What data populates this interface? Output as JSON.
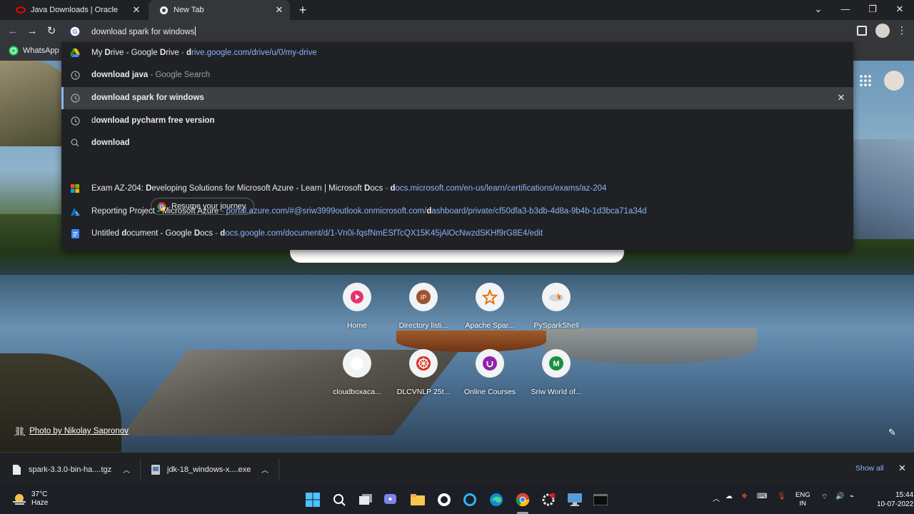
{
  "tabs": [
    {
      "title": "Java Downloads | Oracle",
      "active": false
    },
    {
      "title": "New Tab",
      "active": true
    }
  ],
  "omnibox": {
    "query": "download spark for windows"
  },
  "bookmarks": [
    {
      "label": "WhatsApp"
    }
  ],
  "suggestions": [
    {
      "type": "bookmark",
      "icon": "google-drive-icon",
      "pre": "My ",
      "bold": "D",
      "mid": "rive - Google ",
      "bold2": "D",
      "post": "rive",
      "sep": " - ",
      "url_bold": "d",
      "url": "rive.google.com/drive/u/0/my-drive"
    },
    {
      "type": "history",
      "icon": "history-icon",
      "bold": "download java",
      "dim": " - Google Search"
    },
    {
      "type": "history",
      "icon": "history-icon",
      "bold": "download spark for windows",
      "selected": true
    },
    {
      "type": "history",
      "icon": "history-icon",
      "plain": "d",
      "bold": "ownload pycharm free version"
    },
    {
      "type": "search",
      "icon": "search-icon",
      "bold": "download"
    },
    {
      "type": "page",
      "icon": "microsoft-icon",
      "text": "Exam AZ-204: ",
      "bold": "D",
      "text2": "eveloping Solutions for Microsoft Azure - Learn | Microsoft ",
      "bold2": "D",
      "text3": "ocs",
      "sep": " - ",
      "url_bold": "d",
      "url": "ocs.microsoft.com/en-us/learn/certifications/exams/az-204"
    },
    {
      "type": "page",
      "icon": "azure-icon",
      "text": "Reporting Project - Microsoft Azure",
      "sep": " - ",
      "url": "portal.azure.com/#@sriw3999outlook.onmicrosoft.com/",
      "url_bold": "d",
      "url2": "ashboard/private/cf50dfa3-b3db-4d8a-9b4b-1d3bca71a34d"
    },
    {
      "type": "page",
      "icon": "google-docs-icon",
      "text": "Untitled ",
      "bold": "d",
      "text2": "ocument - Google ",
      "bold2": "D",
      "text3": "ocs",
      "sep": " - ",
      "url_bold": "d",
      "url": "ocs.google.com/document/d/1-Vn0i-fqsfNmESfTcQX15K45jAlOcNwzdSKHf9rG8E4/edit"
    }
  ],
  "journey_chip": "Resume your journey",
  "shortcuts": [
    {
      "label": "Home",
      "color": "#e8336d"
    },
    {
      "label": "Directory listi...",
      "color": "#a0522d"
    },
    {
      "label": "Apache Spar...",
      "color": "#e8710a"
    },
    {
      "label": "PySparkShell",
      "color": "#e8710a"
    },
    {
      "label": "cloudboxaca...",
      "color": "#5f6368"
    },
    {
      "label": "DLCVNLP 25t...",
      "color": "#d93025"
    },
    {
      "label": "Online Courses",
      "color": "#8e24aa"
    },
    {
      "label": "Sriw World of...",
      "color": "#1e8e3e"
    }
  ],
  "shortcut_letters": {
    "directory": "IP",
    "sriw": "M"
  },
  "photo_credit": "Photo by Nikolay Sapronov",
  "downloads": [
    {
      "name": "spark-3.3.0-bin-ha....tgz"
    },
    {
      "name": "jdk-18_windows-x....exe"
    }
  ],
  "show_all": "Show all",
  "taskbar": {
    "temp": "37°C",
    "condition": "Haze",
    "lang1": "ENG",
    "lang2": "IN",
    "time": "15:44",
    "date": "10-07-2022"
  }
}
